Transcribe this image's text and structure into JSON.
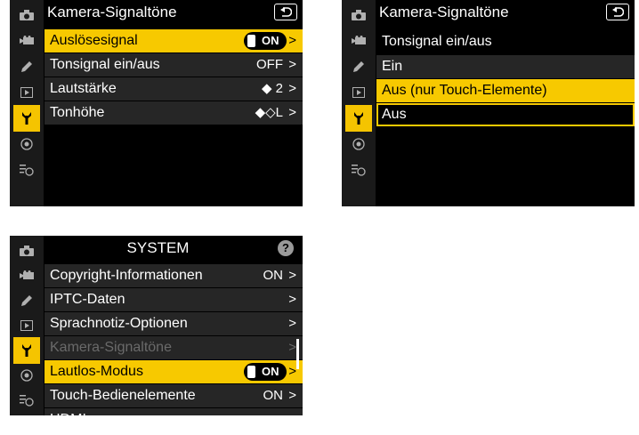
{
  "colors": {
    "highlight": "#f7c900",
    "row_bg": "#262626",
    "screen_bg": "#000000",
    "sidebar_bg": "#1a1a1a"
  },
  "sidebar_icons": [
    "camera-icon",
    "video-icon",
    "pencil-icon",
    "playback-icon",
    "wrench-icon",
    "network-icon",
    "my-menu-icon"
  ],
  "screen1": {
    "title": "Kamera-Signaltöne",
    "items": [
      {
        "label": "Auslösesignal",
        "value": "ON",
        "selected": true
      },
      {
        "label": "Tonsignal ein/aus",
        "value": "OFF"
      },
      {
        "label": "Lautstärke",
        "value": "◆ 2"
      },
      {
        "label": "Tonhöhe",
        "value": "◆◇L"
      }
    ],
    "chevron": ">"
  },
  "screen2": {
    "title": "Kamera-Signaltöne",
    "subtitle": "Tonsignal ein/aus",
    "options": [
      {
        "label": "Ein"
      },
      {
        "label": "Aus (nur Touch-Elemente)",
        "selected": true
      },
      {
        "label": "Aus",
        "focused": true
      }
    ]
  },
  "screen3": {
    "title": "SYSTEM",
    "help": "?",
    "items": [
      {
        "label": "Copyright-Informationen",
        "value": "ON"
      },
      {
        "label": "IPTC-Daten",
        "value": ""
      },
      {
        "label": "Sprachnotiz-Optionen",
        "value": ""
      },
      {
        "label": "Kamera-Signaltöne",
        "value": "",
        "disabled": true
      },
      {
        "label": "Lautlos-Modus",
        "value": "ON",
        "selected": true
      },
      {
        "label": "Touch-Bedienelemente",
        "value": "ON"
      },
      {
        "label": "HDMI",
        "value": ""
      }
    ],
    "chevron": ">"
  }
}
